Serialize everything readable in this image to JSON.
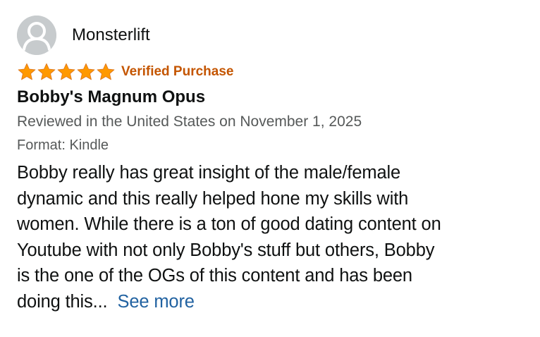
{
  "reviewer": {
    "name": "Monsterlift",
    "avatar_icon": "default-user-avatar-icon"
  },
  "rating": {
    "stars": 5,
    "max_stars": 5,
    "star_color": "#ff9900",
    "verified_label": "Verified Purchase",
    "verified_color": "#c45500"
  },
  "review": {
    "title": "Bobby's Magnum Opus",
    "date_line": "Reviewed in the United States on November 1, 2025",
    "format_line": "Format: Kindle",
    "body_lines": [
      "Bobby really has great insight of the male/female",
      "dynamic and this really helped hone my skills with",
      "women. While there is a ton of good dating content on",
      "Youtube with not only Bobby's stuff but others, Bobby",
      "is the one of the OGs of this content and has been",
      "doing this..."
    ],
    "see_more_label": "See more",
    "link_color": "#2162a1"
  }
}
